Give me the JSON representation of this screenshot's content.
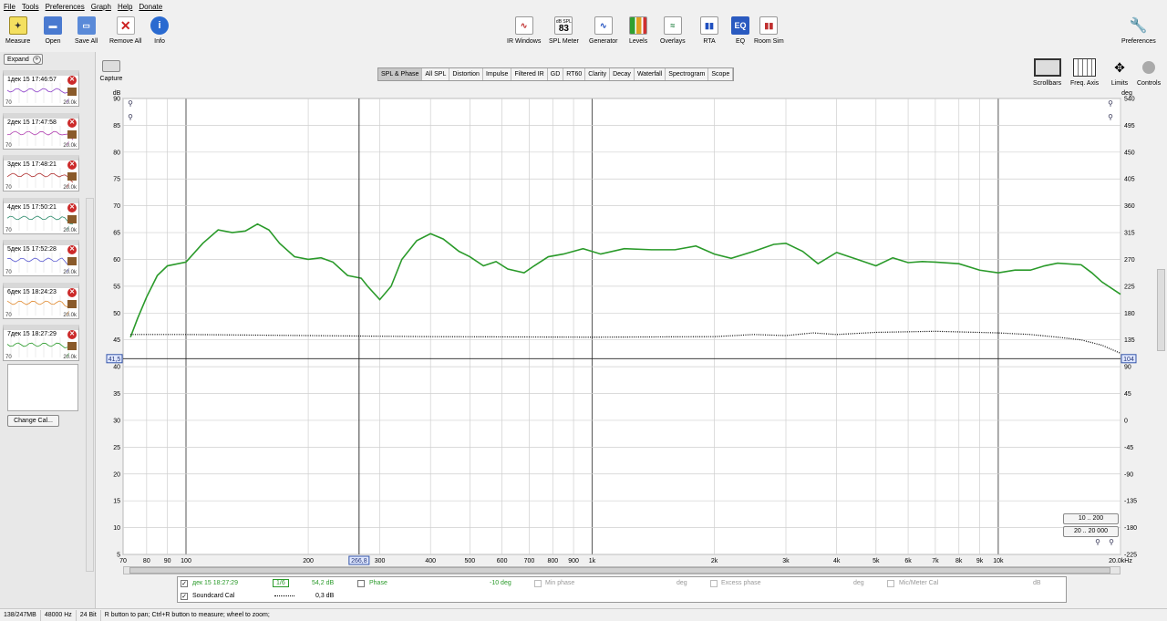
{
  "menu": [
    "File",
    "Tools",
    "Preferences",
    "Graph",
    "Help",
    "Donate"
  ],
  "toolbar_left": [
    {
      "label": "Measure",
      "icon": "measure-icon"
    },
    {
      "label": "Open",
      "icon": "folder-icon"
    },
    {
      "label": "Save All",
      "icon": "save-icon"
    },
    {
      "label": "Remove All",
      "icon": "remove-icon"
    },
    {
      "label": "Info",
      "icon": "info-icon"
    }
  ],
  "toolbar_center": [
    {
      "label": "IR Windows",
      "icon": "ir-windows-icon"
    },
    {
      "label": "SPL Meter",
      "icon": "spl-meter-icon",
      "badge_top": "dB SPL",
      "badge_value": "83"
    },
    {
      "label": "Generator",
      "icon": "generator-icon"
    },
    {
      "label": "Levels",
      "icon": "levels-icon"
    },
    {
      "label": "Overlays",
      "icon": "overlays-icon"
    },
    {
      "label": "RTA",
      "icon": "rta-icon"
    },
    {
      "label": "EQ",
      "icon": "eq-icon"
    },
    {
      "label": "Room Sim",
      "icon": "room-sim-icon"
    }
  ],
  "toolbar_right": {
    "label": "Preferences",
    "icon": "wrench-icon"
  },
  "expand_label": "Expand",
  "measurements": [
    {
      "num": "1",
      "title": "дек 15 17:46:57",
      "color": "#8a3cc8"
    },
    {
      "num": "2",
      "title": "дек 15 17:47:58",
      "color": "#b040b0"
    },
    {
      "num": "3",
      "title": "дек 15 17:48:21",
      "color": "#b03030"
    },
    {
      "num": "4",
      "title": "дек 15 17:50:21",
      "color": "#2a8a6a"
    },
    {
      "num": "5",
      "title": "дек 15 17:52:28",
      "color": "#5a5ad0"
    },
    {
      "num": "6",
      "title": "дек 15 18:24:23",
      "color": "#e08a30"
    },
    {
      "num": "7",
      "title": "дек 15 18:27:29",
      "color": "#2a9a2a"
    }
  ],
  "meas_low": "70",
  "meas_high": "20.0k",
  "change_cal": "Change Cal...",
  "capture_label": "Capture",
  "tabs": [
    "SPL & Phase",
    "All SPL",
    "Distortion",
    "Impulse",
    "Filtered IR",
    "GD",
    "RT60",
    "Clarity",
    "Decay",
    "Waterfall",
    "Spectrogram",
    "Scope"
  ],
  "active_tab": "SPL & Phase",
  "right_tools": [
    "Scrollbars",
    "Freq. Axis",
    "Limits",
    "Controls"
  ],
  "range_buttons": [
    "10 .. 200",
    "20 .. 20 000"
  ],
  "chart_data": {
    "type": "line",
    "x_scale": "log",
    "xlim": [
      70,
      20000
    ],
    "ylim": [
      5,
      90
    ],
    "y2lim": [
      -225,
      540
    ],
    "ylabel": "dB",
    "y2label": "deg",
    "x_ticks": [
      "70",
      "80",
      "90",
      "100",
      "200",
      "300",
      "400",
      "500",
      "600",
      "700",
      "800",
      "900",
      "1k",
      "2k",
      "3k",
      "4k",
      "5k",
      "6k",
      "7k",
      "8k",
      "9k",
      "10k",
      "20.0kHz"
    ],
    "y_ticks": [
      90,
      85,
      80,
      75,
      70,
      65,
      60,
      55,
      50,
      45,
      40,
      35,
      30,
      25,
      20,
      15,
      10,
      5
    ],
    "y2_ticks": [
      540,
      495,
      450,
      405,
      360,
      315,
      270,
      225,
      180,
      135,
      90,
      45,
      0,
      -45,
      -90,
      -135,
      -180,
      -225
    ],
    "cursor": {
      "x_label": "266,8",
      "y_label": "41,5",
      "y2_label": "104"
    },
    "series": [
      {
        "name": "дек 15 18:27:29",
        "color": "#2a9a2a",
        "style": "solid",
        "points": [
          [
            73,
            45.5
          ],
          [
            76,
            49
          ],
          [
            80,
            53
          ],
          [
            85,
            57
          ],
          [
            90,
            58.8
          ],
          [
            100,
            59.5
          ],
          [
            110,
            63
          ],
          [
            120,
            65.5
          ],
          [
            130,
            65
          ],
          [
            140,
            65.3
          ],
          [
            150,
            66.6
          ],
          [
            160,
            65.5
          ],
          [
            170,
            63
          ],
          [
            185,
            60.5
          ],
          [
            200,
            60
          ],
          [
            215,
            60.3
          ],
          [
            230,
            59.5
          ],
          [
            250,
            57
          ],
          [
            270,
            56.5
          ],
          [
            280,
            55
          ],
          [
            300,
            52.5
          ],
          [
            320,
            55
          ],
          [
            340,
            60
          ],
          [
            370,
            63.5
          ],
          [
            400,
            64.8
          ],
          [
            430,
            63.8
          ],
          [
            470,
            61.5
          ],
          [
            500,
            60.5
          ],
          [
            540,
            58.8
          ],
          [
            580,
            59.6
          ],
          [
            620,
            58.2
          ],
          [
            680,
            57.5
          ],
          [
            720,
            58.8
          ],
          [
            780,
            60.5
          ],
          [
            850,
            61
          ],
          [
            950,
            62
          ],
          [
            1050,
            61
          ],
          [
            1200,
            62
          ],
          [
            1400,
            61.8
          ],
          [
            1600,
            61.8
          ],
          [
            1800,
            62.5
          ],
          [
            2000,
            61
          ],
          [
            2200,
            60.2
          ],
          [
            2500,
            61.5
          ],
          [
            2800,
            62.8
          ],
          [
            3000,
            63
          ],
          [
            3300,
            61.5
          ],
          [
            3600,
            59.2
          ],
          [
            4000,
            61.3
          ],
          [
            4500,
            60
          ],
          [
            5000,
            58.8
          ],
          [
            5500,
            60.3
          ],
          [
            6000,
            59.4
          ],
          [
            6500,
            59.6
          ],
          [
            7000,
            59.5
          ],
          [
            8000,
            59.2
          ],
          [
            9000,
            58
          ],
          [
            10000,
            57.5
          ],
          [
            11000,
            58
          ],
          [
            12000,
            58
          ],
          [
            13000,
            58.8
          ],
          [
            14000,
            59.3
          ],
          [
            16000,
            59
          ],
          [
            17000,
            57.5
          ],
          [
            18000,
            55.8
          ],
          [
            20000,
            53.5
          ]
        ]
      },
      {
        "name": "Soundcard Cal",
        "color": "#000000",
        "style": "dotted",
        "points": [
          [
            73,
            46
          ],
          [
            100,
            46
          ],
          [
            200,
            45.8
          ],
          [
            400,
            45.6
          ],
          [
            1000,
            45.5
          ],
          [
            2000,
            45.6
          ],
          [
            2500,
            46
          ],
          [
            3000,
            45.8
          ],
          [
            3500,
            46.3
          ],
          [
            4000,
            46
          ],
          [
            5000,
            46.4
          ],
          [
            7000,
            46.6
          ],
          [
            10000,
            46.3
          ],
          [
            12000,
            46
          ],
          [
            14000,
            45.5
          ],
          [
            16000,
            45
          ],
          [
            18000,
            44
          ],
          [
            20000,
            42.5
          ]
        ]
      }
    ]
  },
  "legend": [
    {
      "checked": true,
      "name": "дек 15 18:27:29",
      "smoothing": "1/6",
      "level": "54,2 dB",
      "phase_label": "Phase",
      "phase_value": "-10 deg",
      "min_phase": "Min phase",
      "min_phase_unit": "deg",
      "excess_phase": "Excess phase",
      "excess_unit": "deg",
      "mic_cal": "Mic/Meter Cal",
      "mic_unit": "dB",
      "color": "#2a9a2a"
    },
    {
      "checked": true,
      "name": "Soundcard Cal",
      "level": "0,3 dB"
    }
  ],
  "status": [
    "138/247MB",
    "48000 Hz",
    "24 Bit",
    "R button to pan; Ctrl+R button to measure; wheel to zoom;"
  ]
}
